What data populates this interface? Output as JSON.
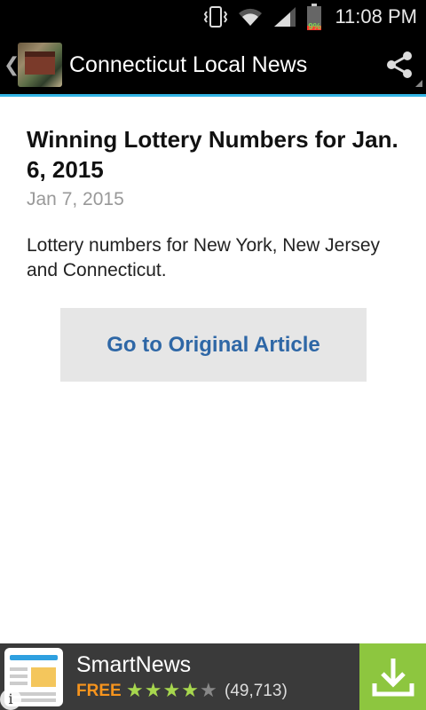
{
  "status_bar": {
    "time": "11:08 PM",
    "battery_percent": "9%",
    "icons": [
      "vibrate-icon",
      "wifi-icon",
      "signal-icon",
      "battery-icon"
    ]
  },
  "action_bar": {
    "title": "Connecticut Local News",
    "up_icon": "chevron-left-icon",
    "share_icon": "share-icon"
  },
  "article": {
    "headline": "Winning Lottery Numbers for Jan. 6, 2015",
    "date": "Jan 7, 2015",
    "summary": "Lottery numbers for New York, New Jersey and Connecticut.",
    "original_button_label": "Go to Original Article"
  },
  "ad": {
    "app_name": "SmartNews",
    "price": "FREE",
    "rating": 4.5,
    "rating_count": "(49,713)",
    "info_label": "i",
    "download_icon": "download-icon",
    "colors": {
      "download_bg": "#8dc63f",
      "price": "#f7941d",
      "stars": "#a7d74e"
    }
  },
  "colors": {
    "accent": "#33b5e5",
    "link": "#2e67a6"
  }
}
